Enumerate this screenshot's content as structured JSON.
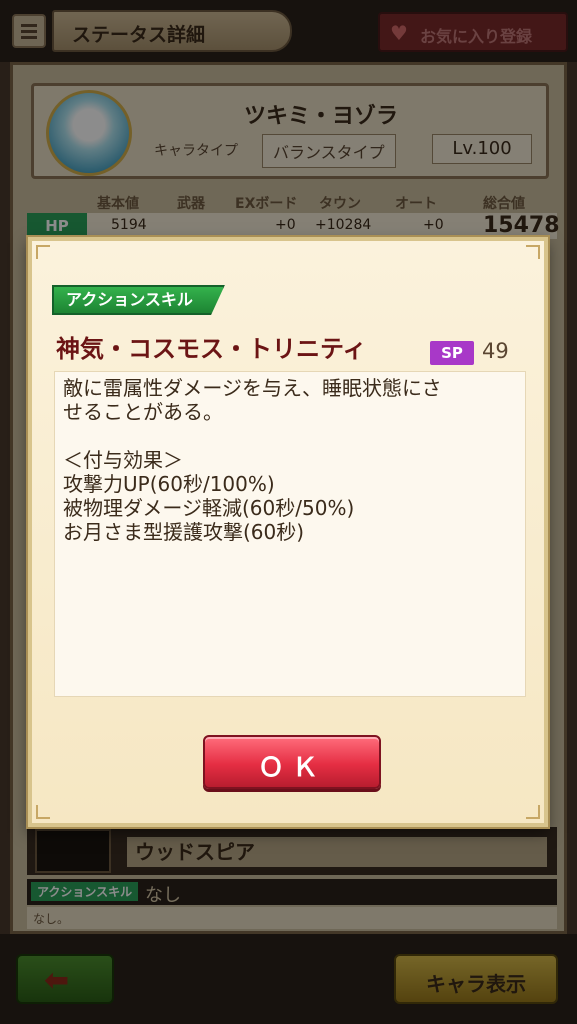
{
  "header": {
    "title": "ステータス詳細",
    "favorite_label": "お気に入り登録"
  },
  "character": {
    "name": "ツキミ・ヨゾラ",
    "type_label": "キャラタイプ",
    "type_value": "バランスタイプ",
    "level": "Lv.100"
  },
  "stats": {
    "headers": [
      "基本値",
      "武器",
      "EXボード",
      "タウン",
      "オート",
      "総合値"
    ],
    "hp_label": "HP",
    "hp_values": [
      "5194",
      "",
      "+0",
      "+10284",
      "+0"
    ],
    "hp_total": "15478"
  },
  "equipment": {
    "weapon_name": "ウッドスピア",
    "action_skill_label": "アクションスキル",
    "action_skill_value": "なし",
    "action_skill_desc": "なし。"
  },
  "bottom": {
    "view_label": "キャラ表示"
  },
  "modal": {
    "tag": "アクションスキル",
    "skill_name": "神気・コスモス・トリニティ",
    "sp_label": "SP",
    "sp_value": "49",
    "description_lines": [
      "敵に雷属性ダメージを与え、睡眠状態にさ",
      "せることがある。",
      "",
      "＜付与効果＞",
      "攻撃力UP(60秒/100%)",
      "被物理ダメージ軽減(60秒/50%)",
      "お月さま型援護攻撃(60秒)"
    ],
    "ok_label": "ＯＫ"
  },
  "colors": {
    "accent_green": "#2aa15a",
    "ok_red": "#e52e43",
    "sp_purple": "#a838c8",
    "skill_name": "#6b1414"
  }
}
